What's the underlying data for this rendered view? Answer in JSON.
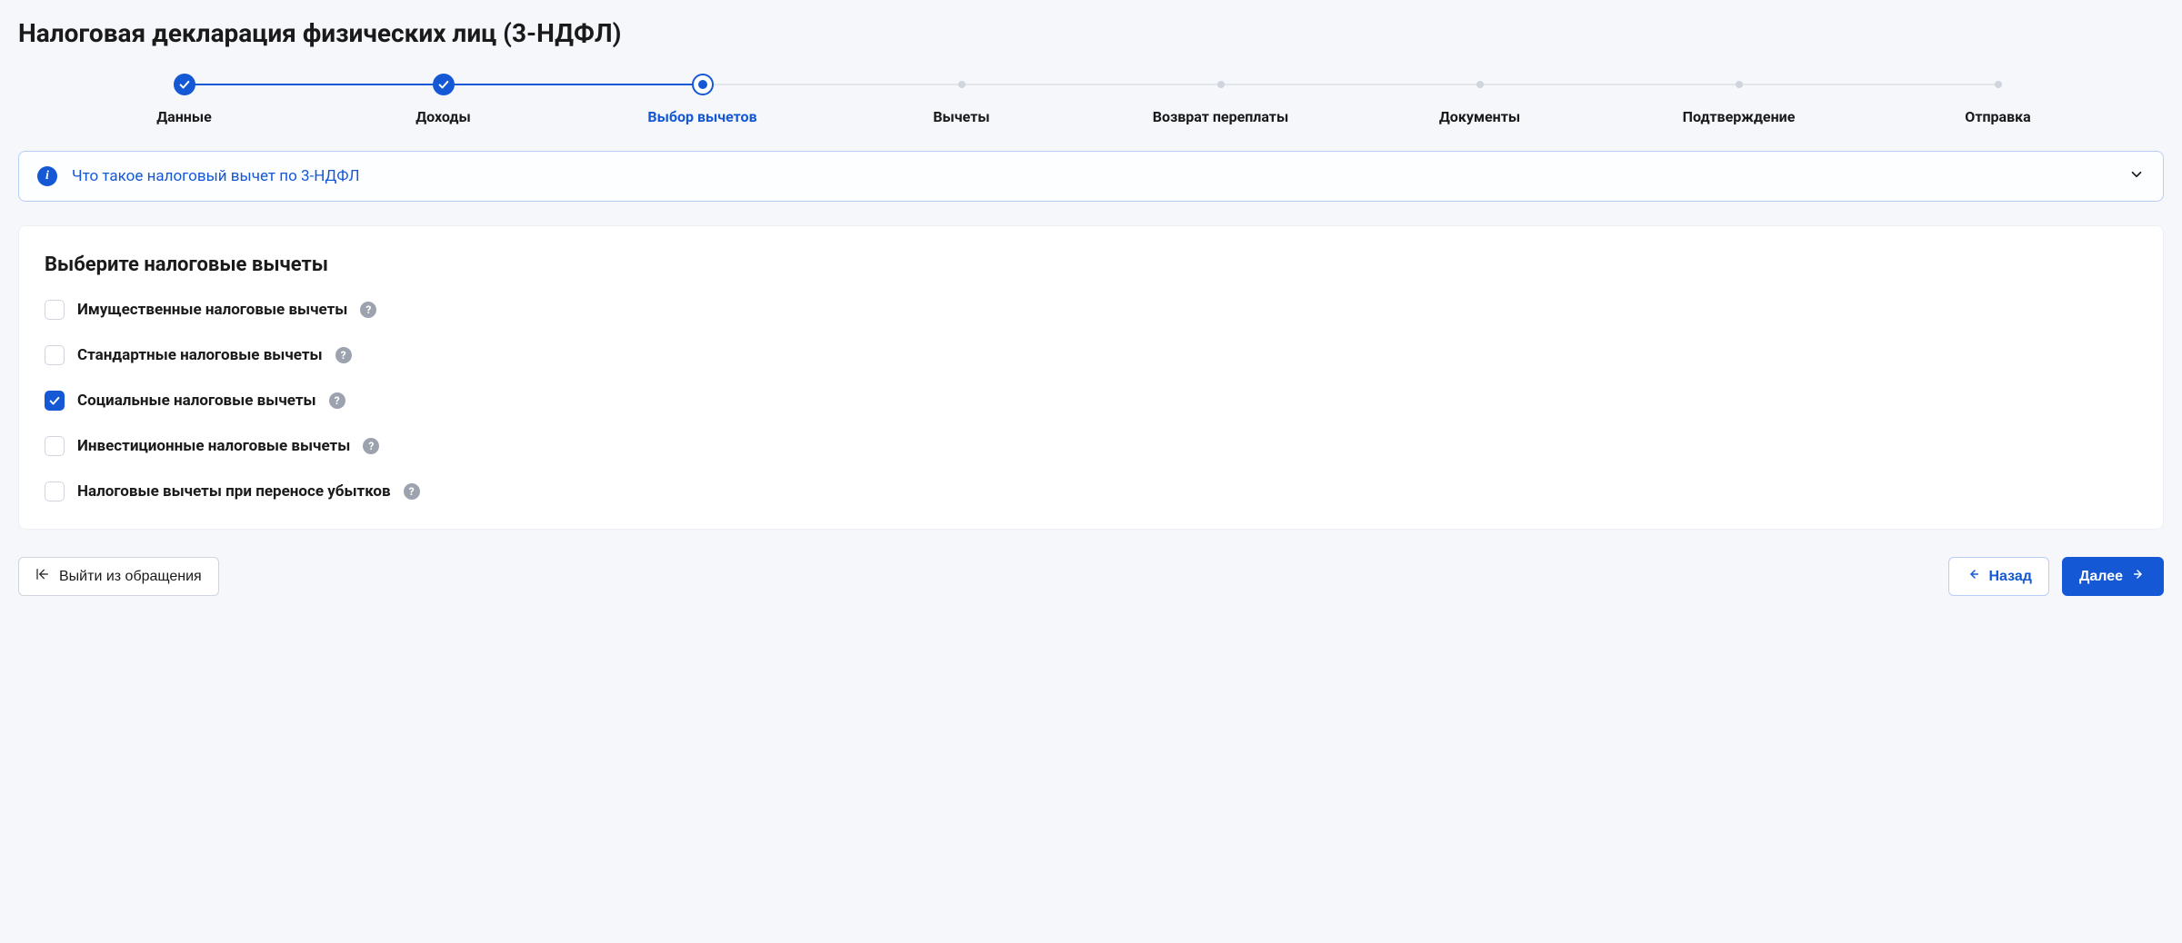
{
  "page_title": "Налоговая декларация физических лиц (3-НДФЛ)",
  "stepper": {
    "steps": [
      {
        "label": "Данные",
        "state": "done"
      },
      {
        "label": "Доходы",
        "state": "done"
      },
      {
        "label": "Выбор вычетов",
        "state": "active"
      },
      {
        "label": "Вычеты",
        "state": "future"
      },
      {
        "label": "Возврат переплаты",
        "state": "future"
      },
      {
        "label": "Документы",
        "state": "future"
      },
      {
        "label": "Подтверждение",
        "state": "future"
      },
      {
        "label": "Отправка",
        "state": "future"
      }
    ]
  },
  "info_banner": {
    "text": "Что такое налоговый вычет по 3-НДФЛ"
  },
  "card": {
    "title": "Выберите налоговые вычеты",
    "items": [
      {
        "label": "Имущественные налоговые вычеты",
        "checked": false
      },
      {
        "label": "Стандартные налоговые вычеты",
        "checked": false
      },
      {
        "label": "Социальные налоговые вычеты",
        "checked": true
      },
      {
        "label": "Инвестиционные налоговые вычеты",
        "checked": false
      },
      {
        "label": "Налоговые вычеты при переносе убытков",
        "checked": false
      }
    ]
  },
  "footer": {
    "exit": "Выйти из обращения",
    "back": "Назад",
    "next": "Далее"
  }
}
